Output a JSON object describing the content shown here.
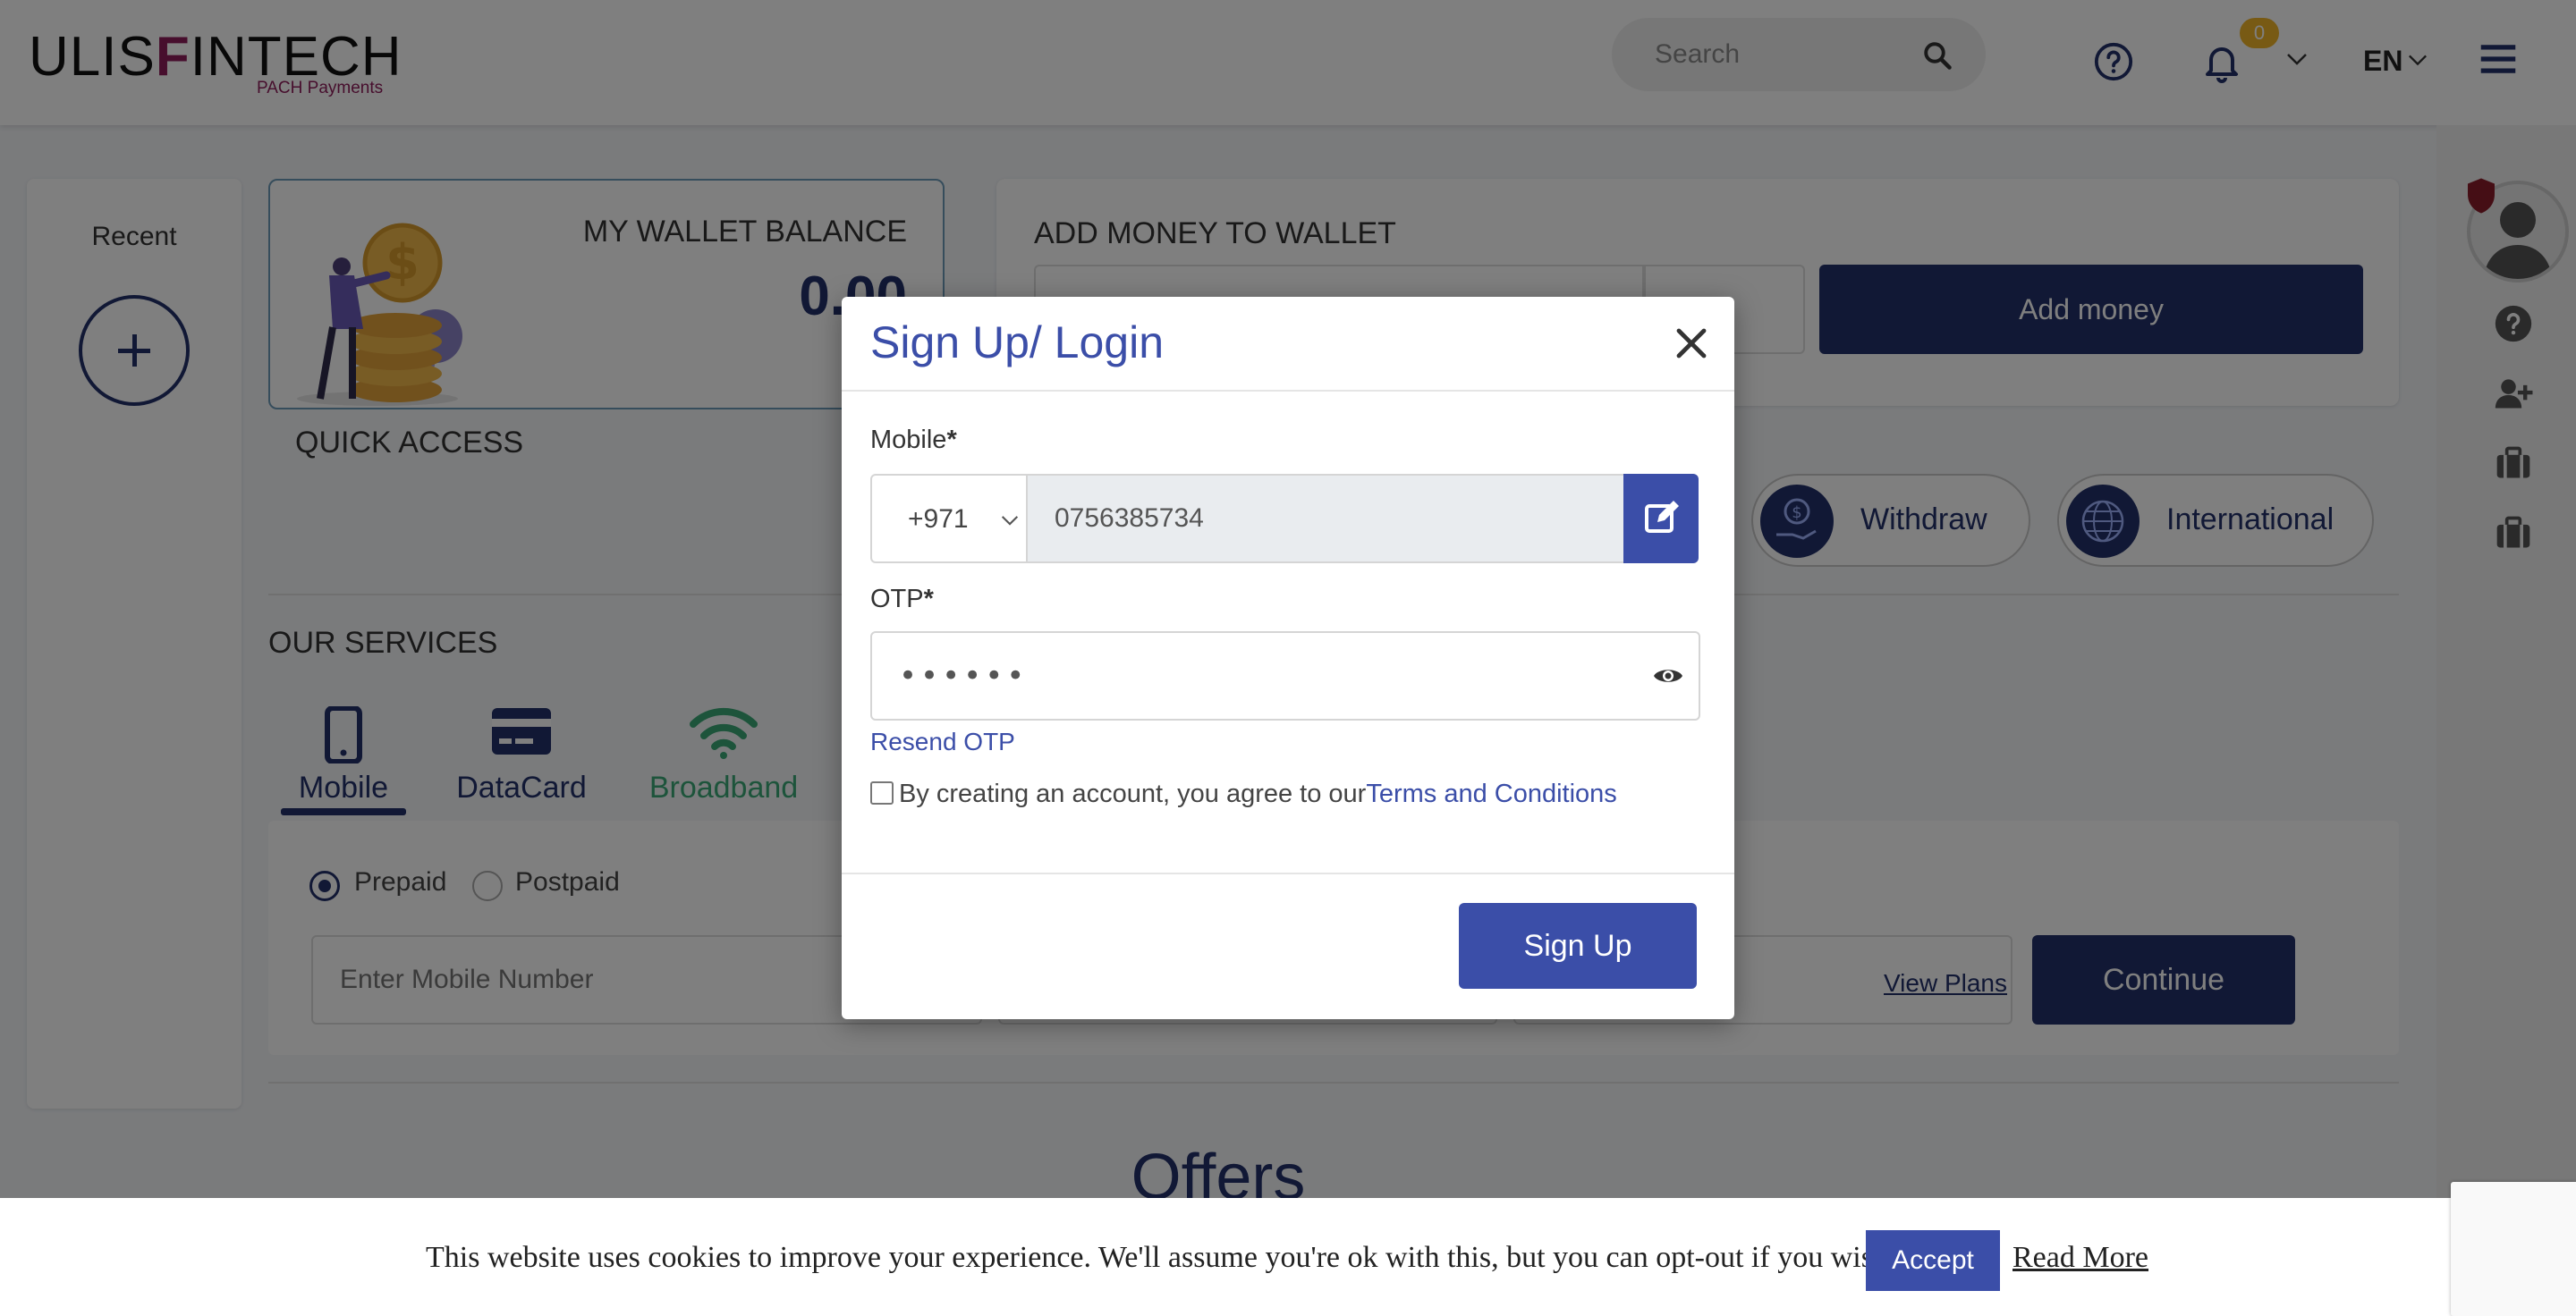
{
  "header": {
    "logo_main_left": "ULIS",
    "logo_main_f": "F",
    "logo_main_right": "INTECH",
    "logo_sub": "PACH Payments",
    "search_placeholder": "Search",
    "notification_count": "0",
    "language": "EN"
  },
  "sidebar": {
    "recent_title": "Recent"
  },
  "wallet": {
    "label": "MY WALLET BALANCE",
    "amount": "0.00"
  },
  "add_money": {
    "title": "ADD MONEY TO WALLET",
    "button_label": "Add money"
  },
  "quick_access": {
    "title": "QUICK ACCESS",
    "items": [
      {
        "label": "Withdraw",
        "icon": "withdraw-hand-icon"
      },
      {
        "label": "International",
        "icon": "globe-icon"
      }
    ]
  },
  "services": {
    "title": "OUR SERVICES",
    "tabs": [
      {
        "label": "Mobile",
        "icon": "mobile-phone-icon",
        "active": true
      },
      {
        "label": "DataCard",
        "icon": "credit-card-icon",
        "active": false
      },
      {
        "label": "Broadband",
        "icon": "wifi-icon",
        "active": false
      }
    ],
    "plan_types": [
      "Prepaid",
      "Postpaid"
    ],
    "selected_plan_type": "Prepaid",
    "mobile_placeholder": "Enter Mobile Number",
    "view_plans_label": "View Plans",
    "continue_label": "Continue"
  },
  "offers": {
    "title": "Offers"
  },
  "modal": {
    "title": "Sign Up/ Login",
    "mobile_label": "Mobile",
    "required_mark": "*",
    "country_code": "+971",
    "mobile_value": "0756385734",
    "otp_label": "OTP",
    "otp_value": "••••••",
    "resend_label": "Resend OTP",
    "terms_prefix": "By creating an account, you agree to our",
    "terms_link": "Terms and Conditions",
    "submit_label": "Sign Up"
  },
  "cookie": {
    "message": "This website uses cookies to improve your experience. We'll assume you're ok with this, but you can opt-out if you wish.",
    "accept_label": "Accept",
    "read_more_label": "Read More"
  },
  "colors": {
    "primary": "#22316b",
    "modal_accent": "#3b4ea8",
    "brand_magenta": "#8e1d5a",
    "badge": "#f0b429",
    "broadband_green": "#3aa876"
  }
}
